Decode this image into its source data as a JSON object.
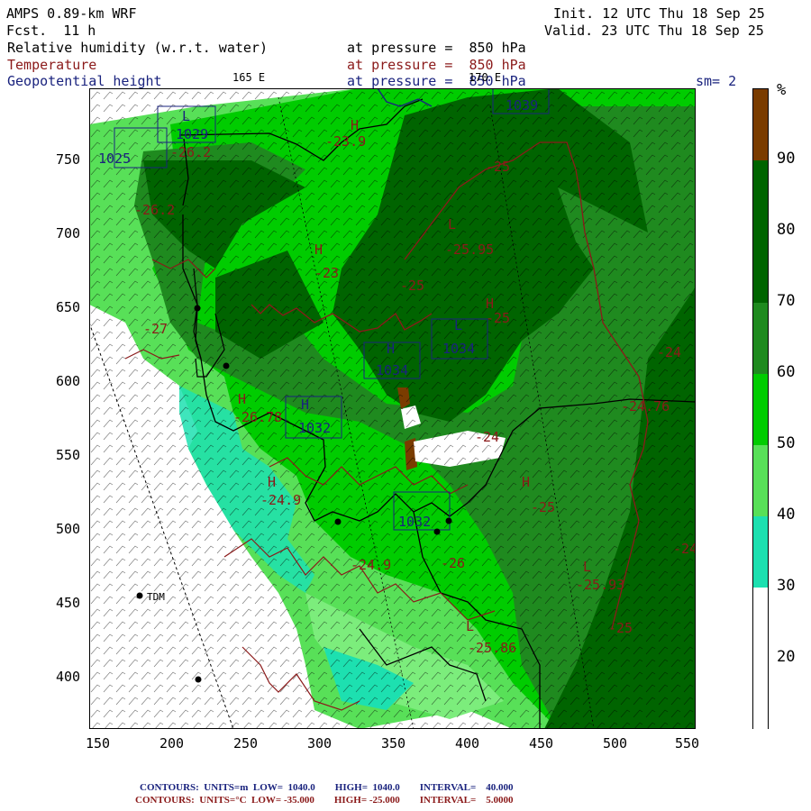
{
  "header": {
    "model": "AMPS 0.89-km WRF",
    "forecast": "Fcst.  11 h",
    "init": "Init. 12 UTC Thu 18 Sep 25",
    "valid": "Valid. 23 UTC Thu 18 Sep 25",
    "line1": "Relative humidity (w.r.t. water)",
    "line2": "Temperature",
    "line3": "Geopotential height",
    "pressure": "at pressure =  850 hPa",
    "lon_165": "165 E",
    "lon_170": "170 E",
    "smoothing": "sm= 2"
  },
  "colorbar": {
    "unit": "%",
    "labels": [
      "90",
      "80",
      "70",
      "60",
      "50",
      "40",
      "30",
      "20"
    ],
    "colors": {
      "c90": "#7a3c00",
      "c80": "#006400",
      "c70": "#1f8a1f",
      "c60": "#00cc00",
      "c50": "#58e058",
      "c40": "#7ced7c",
      "c30": "#1de0b0",
      "c20": "#ffffff"
    }
  },
  "axes": {
    "x": [
      "150",
      "200",
      "250",
      "300",
      "350",
      "400",
      "450",
      "500",
      "550"
    ],
    "y": [
      "750",
      "700",
      "650",
      "600",
      "550",
      "500",
      "450",
      "400"
    ]
  },
  "map_labels": {
    "site": "TDM",
    "lows": [
      "L",
      "L",
      "L",
      "L",
      "L"
    ],
    "highs": [
      "H",
      "H",
      "H",
      "H",
      "H",
      "H",
      "H",
      "H"
    ],
    "heights": [
      "1025",
      "1029",
      "1034",
      "1034",
      "1032",
      "1039",
      "1032"
    ],
    "temps": [
      "-27",
      "-23",
      "-25",
      "-25",
      "-24",
      "-24",
      "-25",
      "-26",
      "-24",
      "-25",
      "-25",
      "-23.9",
      "-25.95",
      "-26.78",
      "-25.93",
      "-24.76",
      "-24.9",
      "-25.86",
      "-24.9",
      "-26.2",
      "-26.2"
    ]
  },
  "footer": {
    "line1": "CONTOURS:  UNITS=m  LOW=  1040.0        HIGH=  1040.0        INTERVAL=    40.000",
    "line2": "CONTOURS:  UNITS=°C  LOW= -35.000        HIGH= -25.000        INTERVAL=    5.0000"
  }
}
